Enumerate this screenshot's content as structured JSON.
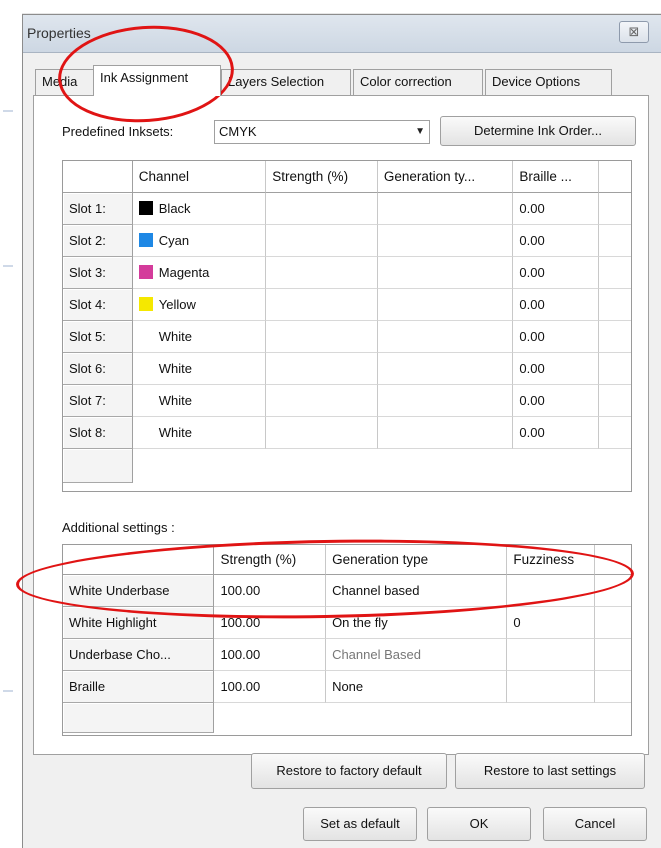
{
  "window": {
    "title": "Properties",
    "close_glyph": "⊠"
  },
  "tabs": [
    {
      "label": "Media"
    },
    {
      "label": "Ink Assignment"
    },
    {
      "label": "Layers Selection"
    },
    {
      "label": "Color correction"
    },
    {
      "label": "Device Options"
    }
  ],
  "inksets": {
    "label": "Predefined Inksets:",
    "value": "CMYK",
    "arrow": "▼"
  },
  "determine_button": "Determine Ink Order...",
  "channels": {
    "headers": [
      "Channel",
      "Strength (%)",
      "Generation ty...",
      "Braille ..."
    ],
    "rows": [
      {
        "slot": "Slot 1:",
        "channel": "Black",
        "swatch": "#000000",
        "strength": "",
        "generation": "",
        "braille": "0.00"
      },
      {
        "slot": "Slot 2:",
        "channel": "Cyan",
        "swatch": "#1e88e5",
        "strength": "",
        "generation": "",
        "braille": "0.00"
      },
      {
        "slot": "Slot 3:",
        "channel": "Magenta",
        "swatch": "#d43b9b",
        "strength": "",
        "generation": "",
        "braille": "0.00"
      },
      {
        "slot": "Slot 4:",
        "channel": "Yellow",
        "swatch": "#f5e800",
        "strength": "",
        "generation": "",
        "braille": "0.00"
      },
      {
        "slot": "Slot 5:",
        "channel": "White",
        "swatch": "",
        "strength": "",
        "generation": "",
        "braille": "0.00"
      },
      {
        "slot": "Slot 6:",
        "channel": "White",
        "swatch": "",
        "strength": "",
        "generation": "",
        "braille": "0.00"
      },
      {
        "slot": "Slot 7:",
        "channel": "White",
        "swatch": "",
        "strength": "",
        "generation": "",
        "braille": "0.00"
      },
      {
        "slot": "Slot 8:",
        "channel": "White",
        "swatch": "",
        "strength": "",
        "generation": "",
        "braille": "0.00"
      }
    ]
  },
  "additional": {
    "label": "Additional settings :",
    "headers": [
      "Strength (%)",
      "Generation type",
      "Fuzziness"
    ],
    "rows": [
      {
        "name": "White Underbase",
        "strength": "100.00",
        "generation": "Channel based",
        "fuzziness": "",
        "grey": false
      },
      {
        "name": "White Highlight",
        "strength": "100.00",
        "generation": "On the fly",
        "fuzziness": "0",
        "grey": false
      },
      {
        "name": "Underbase Cho...",
        "strength": "100.00",
        "generation": "Channel Based",
        "fuzziness": "",
        "grey": true
      },
      {
        "name": "Braille",
        "strength": "100.00",
        "generation": "None",
        "fuzziness": "",
        "grey": false
      }
    ]
  },
  "buttons": {
    "restore_factory": "Restore to factory default",
    "restore_last": "Restore to last settings",
    "set_default": "Set as default",
    "ok": "OK",
    "cancel": "Cancel"
  },
  "colors": {
    "annotation_red": "#e01414"
  }
}
